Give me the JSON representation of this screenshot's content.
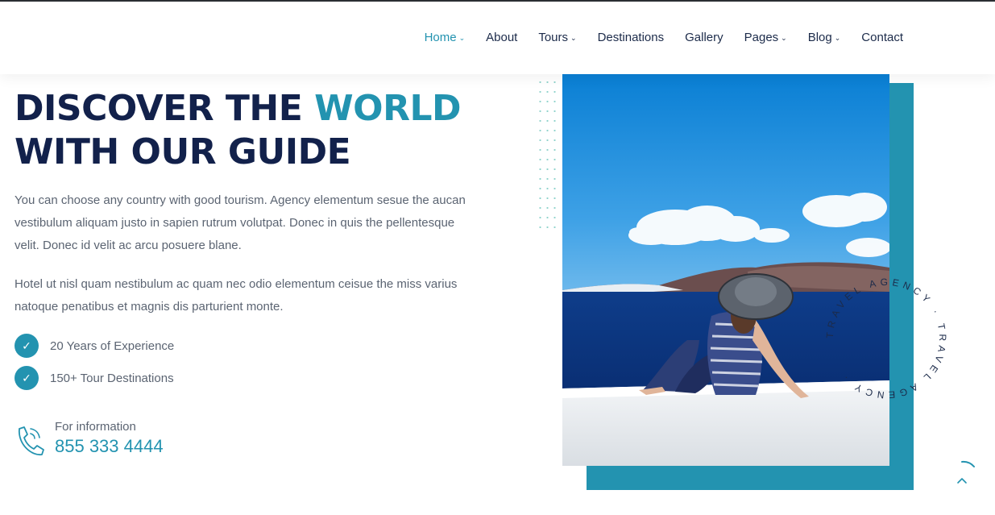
{
  "nav": {
    "items": [
      {
        "label": "Home",
        "active": true,
        "dropdown": true
      },
      {
        "label": "About",
        "active": false,
        "dropdown": false
      },
      {
        "label": "Tours",
        "active": false,
        "dropdown": true
      },
      {
        "label": "Destinations",
        "active": false,
        "dropdown": false
      },
      {
        "label": "Gallery",
        "active": false,
        "dropdown": false
      },
      {
        "label": "Pages",
        "active": false,
        "dropdown": true
      },
      {
        "label": "Blog",
        "active": false,
        "dropdown": true
      },
      {
        "label": "Contact",
        "active": false,
        "dropdown": false
      }
    ],
    "dropdown_icon": "chevron-down-icon"
  },
  "hero": {
    "title_part1": "DISCOVER THE ",
    "title_accent": "WORLD",
    "title_line2": "WITH OUR GUIDE",
    "paragraph1": "You can choose any country with good tourism. Agency elementum sesue the aucan vestibulum aliquam justo in sapien rutrum volutpat. Donec in quis the pellentesque velit. Donec id velit ac arcu posuere blane.",
    "paragraph2": "Hotel ut nisl quam nestibulum ac quam nec odio elementum ceisue the miss varius natoque penatibus et magnis dis parturient monte."
  },
  "features": [
    {
      "icon": "check-icon",
      "label": "20 Years of Experience"
    },
    {
      "icon": "check-icon",
      "label": "150+ Tour Destinations"
    }
  ],
  "contact": {
    "icon": "phone-icon",
    "label": "For information",
    "number": "855 333 4444"
  },
  "badge": {
    "text": "TRAVEL AGENCY · TRAVEL AGENCY ·"
  },
  "scroll_top": {
    "icon": "arrow-up-icon"
  },
  "colors": {
    "accent": "#2393b0",
    "heading": "#12214b",
    "body_text": "#5b6472"
  }
}
